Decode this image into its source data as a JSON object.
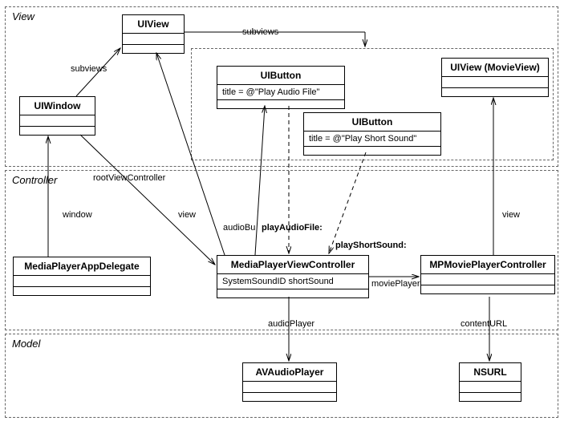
{
  "layers": {
    "view": {
      "label": "View"
    },
    "controller": {
      "label": "Controller"
    },
    "model": {
      "label": "Model"
    }
  },
  "classes": {
    "uiview": {
      "name": "UIView",
      "attrs": ""
    },
    "uiwindow": {
      "name": "UIWindow",
      "attrs": ""
    },
    "uibutton1": {
      "name": "UIButton",
      "attrs": "title = @\"Play Audio File\""
    },
    "uibutton2": {
      "name": "UIButton",
      "attrs": "title = @\"Play Short Sound\""
    },
    "uiview_movie": {
      "name": "UIView (MovieView)",
      "attrs": ""
    },
    "appdelegate": {
      "name": "MediaPlayerAppDelegate",
      "attrs": ""
    },
    "viewcontroller": {
      "name": "MediaPlayerViewController",
      "attrs": "SystemSoundID shortSound"
    },
    "movieplayer": {
      "name": "MPMoviePlayerController",
      "attrs": ""
    },
    "avaudio": {
      "name": "AVAudioPlayer",
      "attrs": ""
    },
    "nsurl": {
      "name": "NSURL",
      "attrs": ""
    }
  },
  "edges": {
    "subviews1": "subviews",
    "subviews2": "subviews",
    "rootViewController": "rootViewController",
    "window": "window",
    "view": "view",
    "audioButton": "audioBu",
    "playAudioFile": "playAudioFile:",
    "playShortSound": "playShortSound:",
    "moviePlayer": "moviePlayer",
    "view2": "view",
    "audioPlayer": "audioPlayer",
    "contentURL": "contentURL"
  },
  "chart_data": {
    "type": "table",
    "title": "UML class/relationship diagram (MVC layers)",
    "layers": [
      "View",
      "Controller",
      "Model"
    ],
    "classes": [
      {
        "name": "UIView",
        "layer": "View",
        "attributes": []
      },
      {
        "name": "UIWindow",
        "layer": "View",
        "attributes": []
      },
      {
        "name": "UIButton",
        "layer": "View",
        "attributes": [
          "title = @\"Play Audio File\""
        ]
      },
      {
        "name": "UIButton",
        "layer": "View",
        "attributes": [
          "title = @\"Play Short Sound\""
        ]
      },
      {
        "name": "UIView (MovieView)",
        "layer": "View",
        "attributes": []
      },
      {
        "name": "MediaPlayerAppDelegate",
        "layer": "Controller",
        "attributes": []
      },
      {
        "name": "MediaPlayerViewController",
        "layer": "Controller",
        "attributes": [
          "SystemSoundID shortSound"
        ]
      },
      {
        "name": "MPMoviePlayerController",
        "layer": "Controller",
        "attributes": []
      },
      {
        "name": "AVAudioPlayer",
        "layer": "Model",
        "attributes": []
      },
      {
        "name": "NSURL",
        "layer": "Model",
        "attributes": []
      }
    ],
    "relationships": [
      {
        "from": "UIWindow",
        "to": "UIView",
        "label": "subviews",
        "style": "solid"
      },
      {
        "from": "UIView",
        "to": "UIView (MovieView)",
        "label": "subviews",
        "style": "solid",
        "via": "subviews container"
      },
      {
        "from": "UIWindow",
        "to": "MediaPlayerViewController",
        "label": "rootViewController",
        "style": "solid"
      },
      {
        "from": "MediaPlayerAppDelegate",
        "to": "UIWindow",
        "label": "window",
        "style": "solid"
      },
      {
        "from": "MediaPlayerViewController",
        "to": "UIView",
        "label": "view",
        "style": "solid"
      },
      {
        "from": "MediaPlayerViewController",
        "to": "UIButton (Play Audio File)",
        "label": "audioButton",
        "style": "solid"
      },
      {
        "from": "UIButton (Play Audio File)",
        "to": "MediaPlayerViewController",
        "label": "playAudioFile:",
        "style": "dashed"
      },
      {
        "from": "UIButton (Play Short Sound)",
        "to": "MediaPlayerViewController",
        "label": "playShortSound:",
        "style": "dashed"
      },
      {
        "from": "MediaPlayerViewController",
        "to": "MPMoviePlayerController",
        "label": "moviePlayer",
        "style": "solid"
      },
      {
        "from": "MPMoviePlayerController",
        "to": "UIView (MovieView)",
        "label": "view",
        "style": "solid"
      },
      {
        "from": "MediaPlayerViewController",
        "to": "AVAudioPlayer",
        "label": "audioPlayer",
        "style": "solid"
      },
      {
        "from": "MPMoviePlayerController",
        "to": "NSURL",
        "label": "contentURL",
        "style": "solid"
      }
    ]
  }
}
